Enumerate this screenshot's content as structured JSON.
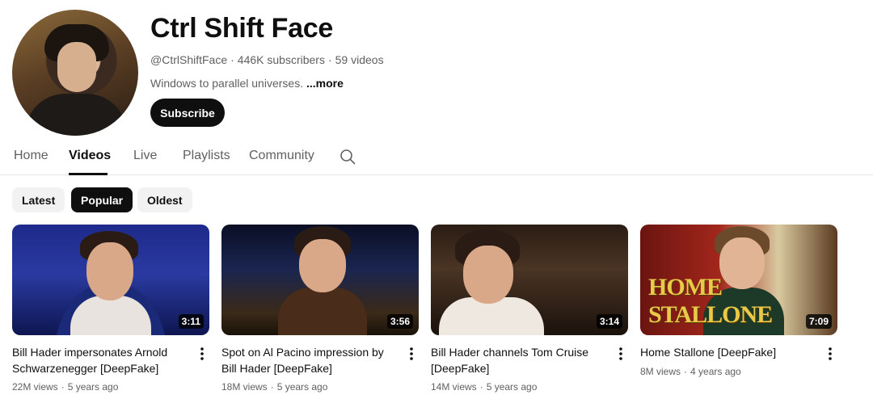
{
  "channel": {
    "name": "Ctrl Shift Face",
    "handle": "@CtrlShiftFace",
    "subscribers": "446K subscribers",
    "video_count": "59 videos",
    "separator": "·",
    "description": "Windows to parallel universes.",
    "more_label": "...more",
    "subscribe_label": "Subscribe"
  },
  "tabs": [
    {
      "label": "Home",
      "active": false
    },
    {
      "label": "Videos",
      "active": true
    },
    {
      "label": "Live",
      "active": false
    },
    {
      "label": "Playlists",
      "active": false
    },
    {
      "label": "Community",
      "active": false
    }
  ],
  "search_icon": "search-icon",
  "filters": [
    {
      "label": "Latest",
      "active": false
    },
    {
      "label": "Popular",
      "active": true
    },
    {
      "label": "Oldest",
      "active": false
    }
  ],
  "videos": [
    {
      "title": "Bill Hader impersonates Arnold Schwarzenegger [DeepFake]",
      "duration": "3:11",
      "views": "22M views",
      "age": "5 years ago"
    },
    {
      "title": "Spot on Al Pacino impression by Bill Hader [DeepFake]",
      "duration": "3:56",
      "views": "18M views",
      "age": "5 years ago"
    },
    {
      "title": "Bill Hader channels Tom Cruise [DeepFake]",
      "duration": "3:14",
      "views": "14M views",
      "age": "5 years ago"
    },
    {
      "title": "Home Stallone [DeepFake]",
      "duration": "7:09",
      "views": "8M views",
      "age": "4 years ago",
      "thumbnail_text": "HOME STALLONE"
    }
  ],
  "colors": {
    "text_primary": "#0f0f0f",
    "text_secondary": "#606060",
    "chip_bg": "#f2f2f2",
    "button_dark": "#0f0f0f"
  }
}
